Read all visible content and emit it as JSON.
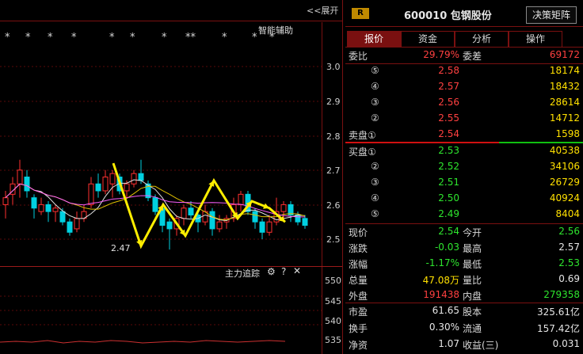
{
  "chart": {
    "expand_label": "<<展开",
    "assist_label": "智能辅助",
    "track_label": "主力追踪",
    "low_label": "2.47",
    "stars": [
      "*",
      "*",
      "*",
      "*",
      "*",
      "*",
      "*",
      "**",
      "*",
      "*",
      "*"
    ],
    "price_ticks": [
      "3.0",
      "2.9",
      "2.8",
      "2.7",
      "2.6",
      "2.5"
    ],
    "volume_ticks": [
      "550",
      "545",
      "540",
      "535"
    ]
  },
  "chart_data": {
    "type": "candlestick",
    "ylim": [
      2.45,
      3.02
    ],
    "low_marker": 2.47,
    "candles": [
      {
        "o": 2.6,
        "c": 2.62,
        "h": 2.64,
        "l": 2.56
      },
      {
        "o": 2.63,
        "c": 2.66,
        "h": 2.68,
        "l": 2.6
      },
      {
        "o": 2.66,
        "c": 2.7,
        "h": 2.73,
        "l": 2.62
      },
      {
        "o": 2.68,
        "c": 2.64,
        "h": 2.7,
        "l": 2.62
      },
      {
        "o": 2.62,
        "c": 2.59,
        "h": 2.63,
        "l": 2.56
      },
      {
        "o": 2.58,
        "c": 2.6,
        "h": 2.62,
        "l": 2.57
      },
      {
        "o": 2.6,
        "c": 2.58,
        "h": 2.61,
        "l": 2.55
      },
      {
        "o": 2.58,
        "c": 2.59,
        "h": 2.6,
        "l": 2.55
      },
      {
        "o": 2.58,
        "c": 2.55,
        "h": 2.59,
        "l": 2.54
      },
      {
        "o": 2.55,
        "c": 2.52,
        "h": 2.56,
        "l": 2.51
      },
      {
        "o": 2.53,
        "c": 2.56,
        "h": 2.58,
        "l": 2.52
      },
      {
        "o": 2.56,
        "c": 2.58,
        "h": 2.6,
        "l": 2.55
      },
      {
        "o": 2.6,
        "c": 2.66,
        "h": 2.68,
        "l": 2.59
      },
      {
        "o": 2.66,
        "c": 2.64,
        "h": 2.69,
        "l": 2.62
      },
      {
        "o": 2.64,
        "c": 2.68,
        "h": 2.7,
        "l": 2.63
      },
      {
        "o": 2.66,
        "c": 2.69,
        "h": 2.7,
        "l": 2.62
      },
      {
        "o": 2.68,
        "c": 2.64,
        "h": 2.69,
        "l": 2.63
      },
      {
        "o": 2.64,
        "c": 2.66,
        "h": 2.67,
        "l": 2.62
      },
      {
        "o": 2.66,
        "c": 2.69,
        "h": 2.7,
        "l": 2.65
      },
      {
        "o": 2.69,
        "c": 2.67,
        "h": 2.73,
        "l": 2.66
      },
      {
        "o": 2.66,
        "c": 2.62,
        "h": 2.67,
        "l": 2.61
      },
      {
        "o": 2.62,
        "c": 2.58,
        "h": 2.63,
        "l": 2.57
      },
      {
        "o": 2.59,
        "c": 2.54,
        "h": 2.6,
        "l": 2.52
      },
      {
        "o": 2.55,
        "c": 2.53,
        "h": 2.56,
        "l": 2.47
      },
      {
        "o": 2.53,
        "c": 2.56,
        "h": 2.57,
        "l": 2.51
      },
      {
        "o": 2.56,
        "c": 2.59,
        "h": 2.6,
        "l": 2.54
      },
      {
        "o": 2.59,
        "c": 2.57,
        "h": 2.61,
        "l": 2.56
      },
      {
        "o": 2.57,
        "c": 2.55,
        "h": 2.58,
        "l": 2.52
      },
      {
        "o": 2.55,
        "c": 2.58,
        "h": 2.6,
        "l": 2.54
      },
      {
        "o": 2.58,
        "c": 2.53,
        "h": 2.59,
        "l": 2.51
      },
      {
        "o": 2.53,
        "c": 2.55,
        "h": 2.57,
        "l": 2.52
      },
      {
        "o": 2.55,
        "c": 2.56,
        "h": 2.57,
        "l": 2.53
      },
      {
        "o": 2.56,
        "c": 2.6,
        "h": 2.62,
        "l": 2.55
      },
      {
        "o": 2.6,
        "c": 2.63,
        "h": 2.64,
        "l": 2.58
      },
      {
        "o": 2.63,
        "c": 2.58,
        "h": 2.64,
        "l": 2.57
      },
      {
        "o": 2.58,
        "c": 2.55,
        "h": 2.59,
        "l": 2.53
      },
      {
        "o": 2.55,
        "c": 2.52,
        "h": 2.56,
        "l": 2.5
      },
      {
        "o": 2.52,
        "c": 2.55,
        "h": 2.57,
        "l": 2.51
      },
      {
        "o": 2.55,
        "c": 2.58,
        "h": 2.62,
        "l": 2.54
      },
      {
        "o": 2.58,
        "c": 2.6,
        "h": 2.61,
        "l": 2.56
      },
      {
        "o": 2.6,
        "c": 2.57,
        "h": 2.61,
        "l": 2.55
      },
      {
        "o": 2.57,
        "c": 2.55,
        "h": 2.58,
        "l": 2.54
      },
      {
        "o": 2.56,
        "c": 2.54,
        "h": 2.57,
        "l": 2.53
      }
    ],
    "arrow_path": [
      2.72,
      2.48,
      2.6,
      2.51,
      2.67,
      2.56,
      2.61,
      2.59,
      2.55
    ]
  },
  "quote": {
    "badge": "R",
    "title": "600010 包钢股份",
    "decision_btn": "决策矩阵",
    "tabs": [
      "报价",
      "资金",
      "分析",
      "操作"
    ],
    "weibi_label": "委比",
    "weibi_value": "29.79%",
    "weicha_label": "委差",
    "weicha_value": "69172",
    "sell": [
      {
        "label": "⑤",
        "price": "2.58",
        "vol": "18174"
      },
      {
        "label": "④",
        "price": "2.57",
        "vol": "18432"
      },
      {
        "label": "③",
        "price": "2.56",
        "vol": "28614"
      },
      {
        "label": "②",
        "price": "2.55",
        "vol": "14712"
      },
      {
        "label": "卖盘①",
        "price": "2.54",
        "vol": "1598"
      }
    ],
    "buy": [
      {
        "label": "买盘①",
        "price": "2.53",
        "vol": "40538"
      },
      {
        "label": "②",
        "price": "2.52",
        "vol": "34106"
      },
      {
        "label": "③",
        "price": "2.51",
        "vol": "26729"
      },
      {
        "label": "④",
        "price": "2.50",
        "vol": "40924"
      },
      {
        "label": "⑤",
        "price": "2.49",
        "vol": "8404"
      }
    ],
    "stats": [
      {
        "l1": "现价",
        "v1": "2.54",
        "c1": "green",
        "l2": "今开",
        "v2": "2.56",
        "c2": "green"
      },
      {
        "l1": "涨跌",
        "v1": "-0.03",
        "c1": "green",
        "l2": "最高",
        "v2": "2.57",
        "c2": "white"
      },
      {
        "l1": "涨幅",
        "v1": "-1.17%",
        "c1": "green",
        "l2": "最低",
        "v2": "2.53",
        "c2": "green"
      },
      {
        "l1": "总量",
        "v1": "47.08万",
        "c1": "yellow",
        "l2": "量比",
        "v2": "0.69",
        "c2": "white"
      },
      {
        "l1": "外盘",
        "v1": "191438",
        "c1": "red",
        "l2": "内盘",
        "v2": "279358",
        "c2": "green"
      }
    ],
    "fundamentals": [
      {
        "l1": "市盈",
        "v1": "61.65",
        "l2": "股本",
        "v2": "325.61亿"
      },
      {
        "l1": "换手",
        "v1": "0.30%",
        "l2": "流通",
        "v2": "157.42亿"
      },
      {
        "l1": "净资",
        "v1": "1.07",
        "l2": "收益(三)",
        "v2": "0.031"
      }
    ]
  }
}
